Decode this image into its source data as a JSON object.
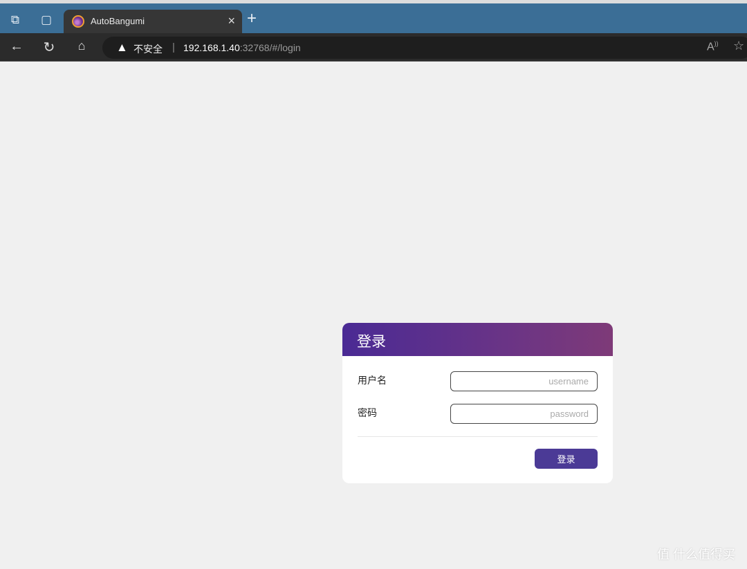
{
  "browser": {
    "tab": {
      "title": "AutoBangumi",
      "close": "×"
    },
    "new_tab": "+",
    "security_label": "不安全",
    "url_host": "192.168.1.40",
    "url_rest": ":32768/#/login",
    "icons": [
      "workspaces-icon",
      "tab-actions-icon",
      "back-icon",
      "refresh-icon",
      "home-icon",
      "warning-icon",
      "read-aloud-icon",
      "add-favorite-icon"
    ]
  },
  "login": {
    "title": "登录",
    "username_label": "用户名",
    "username_placeholder": "username",
    "password_label": "密码",
    "password_placeholder": "password",
    "submit_label": "登录",
    "accent": "#4b3a96",
    "header_gradient": [
      "#4a2a94",
      "#7e3a78"
    ]
  },
  "watermark": "值 什么值得买"
}
